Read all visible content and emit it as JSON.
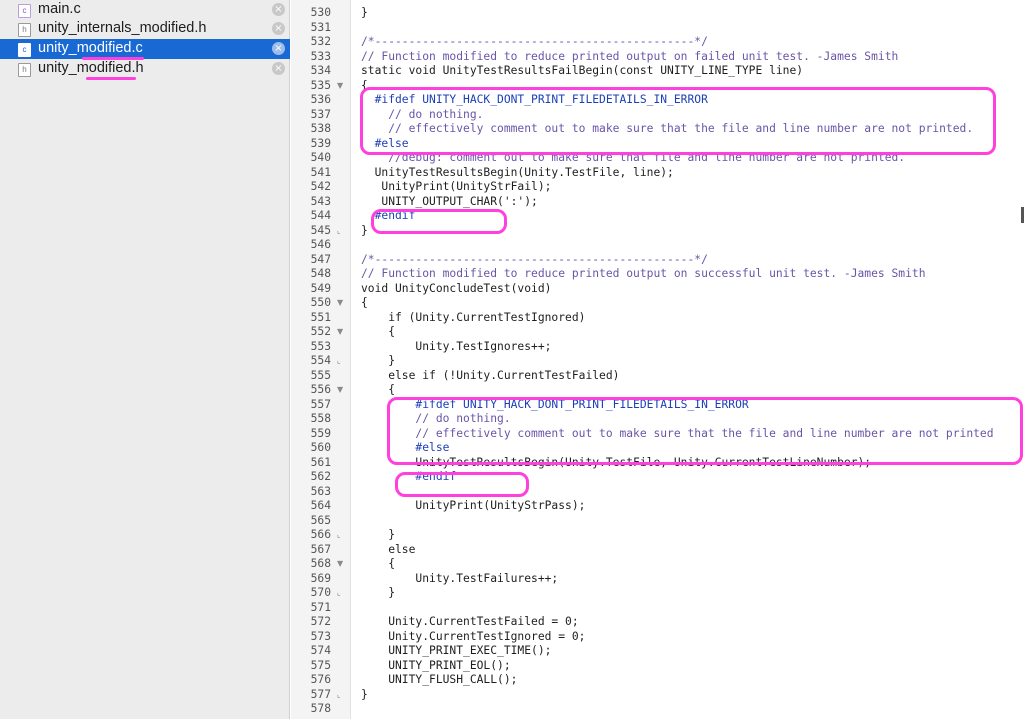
{
  "sidebar": {
    "files": [
      {
        "name": "main.c",
        "icon": "c",
        "selected": false
      },
      {
        "name": "unity_internals_modified.h",
        "icon": "h",
        "selected": false
      },
      {
        "name": "unity_modified.c",
        "icon": "c",
        "selected": true
      },
      {
        "name": "unity_modified.h",
        "icon": "h",
        "selected": false
      }
    ],
    "close_glyph": "×"
  },
  "editor": {
    "lines": [
      {
        "n": "530",
        "fold": "",
        "t": "}"
      },
      {
        "n": "531",
        "fold": "",
        "t": ""
      },
      {
        "n": "532",
        "fold": "",
        "t": "/*-----------------------------------------------*/"
      },
      {
        "n": "533",
        "fold": "",
        "t": "// Function modified to reduce printed output on failed unit test. -James Smith"
      },
      {
        "n": "534",
        "fold": "",
        "t": "static void UnityTestResultsFailBegin(const UNITY_LINE_TYPE line)"
      },
      {
        "n": "535",
        "fold": "▼",
        "t": "{"
      },
      {
        "n": "536",
        "fold": "",
        "t": "  #ifdef UNITY_HACK_DONT_PRINT_FILEDETAILS_IN_ERROR"
      },
      {
        "n": "537",
        "fold": "",
        "t": "    // do nothing."
      },
      {
        "n": "538",
        "fold": "",
        "t": "    // effectively comment out to make sure that the file and line number are not printed."
      },
      {
        "n": "539",
        "fold": "",
        "t": "  #else"
      },
      {
        "n": "540",
        "fold": "",
        "t": "    //debug: comment out to make sure that file and line number are not printed."
      },
      {
        "n": "541",
        "fold": "",
        "t": "  UnityTestResultsBegin(Unity.TestFile, line);"
      },
      {
        "n": "542",
        "fold": "",
        "t": "   UnityPrint(UnityStrFail);"
      },
      {
        "n": "543",
        "fold": "",
        "t": "   UNITY_OUTPUT_CHAR(':');"
      },
      {
        "n": "544",
        "fold": "",
        "t": "  #endif"
      },
      {
        "n": "545",
        "fold": "⌞",
        "t": "}"
      },
      {
        "n": "546",
        "fold": "",
        "t": ""
      },
      {
        "n": "547",
        "fold": "",
        "t": "/*-----------------------------------------------*/"
      },
      {
        "n": "548",
        "fold": "",
        "t": "// Function modified to reduce printed output on successful unit test. -James Smith"
      },
      {
        "n": "549",
        "fold": "",
        "t": "void UnityConcludeTest(void)"
      },
      {
        "n": "550",
        "fold": "▼",
        "t": "{"
      },
      {
        "n": "551",
        "fold": "",
        "t": "    if (Unity.CurrentTestIgnored)"
      },
      {
        "n": "552",
        "fold": "▼",
        "t": "    {"
      },
      {
        "n": "553",
        "fold": "",
        "t": "        Unity.TestIgnores++;"
      },
      {
        "n": "554",
        "fold": "⌞",
        "t": "    }"
      },
      {
        "n": "555",
        "fold": "",
        "t": "    else if (!Unity.CurrentTestFailed)"
      },
      {
        "n": "556",
        "fold": "▼",
        "t": "    {"
      },
      {
        "n": "557",
        "fold": "",
        "t": "        #ifdef UNITY_HACK_DONT_PRINT_FILEDETAILS_IN_ERROR"
      },
      {
        "n": "558",
        "fold": "",
        "t": "        // do nothing."
      },
      {
        "n": "559",
        "fold": "",
        "t": "        // effectively comment out to make sure that the file and line number are not printed"
      },
      {
        "n": "560",
        "fold": "",
        "t": "        #else"
      },
      {
        "n": "561",
        "fold": "",
        "t": "        UnityTestResultsBegin(Unity.TestFile, Unity.CurrentTestLineNumber);"
      },
      {
        "n": "562",
        "fold": "",
        "t": "        #endif"
      },
      {
        "n": "563",
        "fold": "",
        "t": ""
      },
      {
        "n": "564",
        "fold": "",
        "t": "        UnityPrint(UnityStrPass);"
      },
      {
        "n": "565",
        "fold": "",
        "t": ""
      },
      {
        "n": "566",
        "fold": "⌞",
        "t": "    }"
      },
      {
        "n": "567",
        "fold": "",
        "t": "    else"
      },
      {
        "n": "568",
        "fold": "▼",
        "t": "    {"
      },
      {
        "n": "569",
        "fold": "",
        "t": "        Unity.TestFailures++;"
      },
      {
        "n": "570",
        "fold": "⌞",
        "t": "    }"
      },
      {
        "n": "571",
        "fold": "",
        "t": ""
      },
      {
        "n": "572",
        "fold": "",
        "t": "    Unity.CurrentTestFailed = 0;"
      },
      {
        "n": "573",
        "fold": "",
        "t": "    Unity.CurrentTestIgnored = 0;"
      },
      {
        "n": "574",
        "fold": "",
        "t": "    UNITY_PRINT_EXEC_TIME();"
      },
      {
        "n": "575",
        "fold": "",
        "t": "    UNITY_PRINT_EOL();"
      },
      {
        "n": "576",
        "fold": "",
        "t": "    UNITY_FLUSH_CALL();"
      },
      {
        "n": "577",
        "fold": "⌞",
        "t": "}"
      },
      {
        "n": "578",
        "fold": "",
        "t": ""
      }
    ]
  },
  "colors": {
    "selection": "#1869d4",
    "annotation": "#ff3fde",
    "comment": "#6a55a8",
    "keyword": "#1c3fb8",
    "number": "#c45b00"
  }
}
